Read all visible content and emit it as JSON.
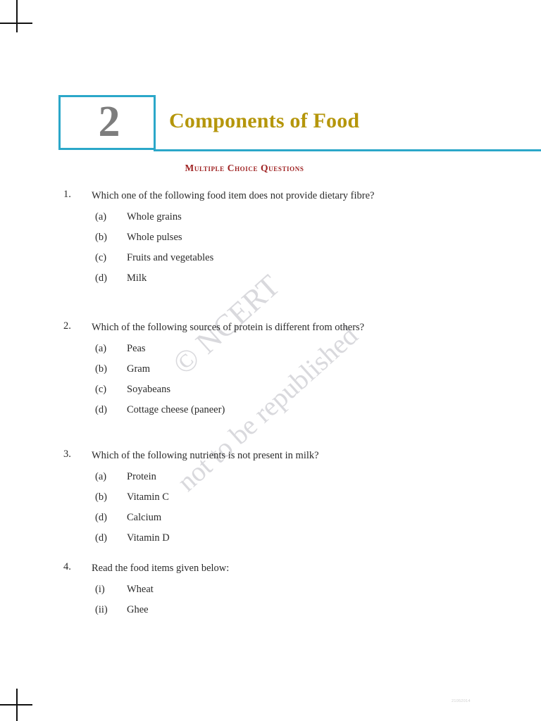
{
  "chapter": {
    "number": "2",
    "title": "Components of Food",
    "box_border_color": "#2ba7c9",
    "number_color": "#7d7d7d",
    "title_color": "#b5960b",
    "rule_color": "#2ba7c9"
  },
  "section": {
    "heading": "Multiple Choice Questions",
    "heading_color": "#9e2020"
  },
  "questions": [
    {
      "number": "1.",
      "text": "Which one of the following food item does not provide dietary fibre?",
      "justify": false,
      "options": [
        {
          "label": "(a)",
          "text": "Whole grains"
        },
        {
          "label": "(b)",
          "text": "Whole pulses"
        },
        {
          "label": "(c)",
          "text": "Fruits and vegetables"
        },
        {
          "label": "(d)",
          "text": "Milk"
        }
      ]
    },
    {
      "number": "2.",
      "text": "Which of the following sources of protein is different from others?",
      "justify": true,
      "options": [
        {
          "label": "(a)",
          "text": "Peas"
        },
        {
          "label": "(b)",
          "text": "Gram"
        },
        {
          "label": "(c)",
          "text": "Soyabeans"
        },
        {
          "label": "(d)",
          "text": "Cottage cheese (paneer)"
        }
      ]
    },
    {
      "number": "3.",
      "text": "Which of the following nutrients is not present in milk?",
      "justify": false,
      "options": [
        {
          "label": "(a)",
          "text": "Protein"
        },
        {
          "label": "(b)",
          "text": "Vitamin C"
        },
        {
          "label": "(d)",
          "text": "Calcium"
        },
        {
          "label": "(d)",
          "text": "Vitamin D"
        }
      ]
    },
    {
      "number": "4.",
      "text": "Read the food items given below:",
      "justify": false,
      "options": [
        {
          "label": "(i)",
          "text": "Wheat"
        },
        {
          "label": "(ii)",
          "text": "Ghee"
        }
      ]
    }
  ],
  "watermark": {
    "copyright": "© NCERT",
    "notice": "not to be republished",
    "color": "#d9d9dd"
  },
  "footer": {
    "stamp": "21052014"
  }
}
